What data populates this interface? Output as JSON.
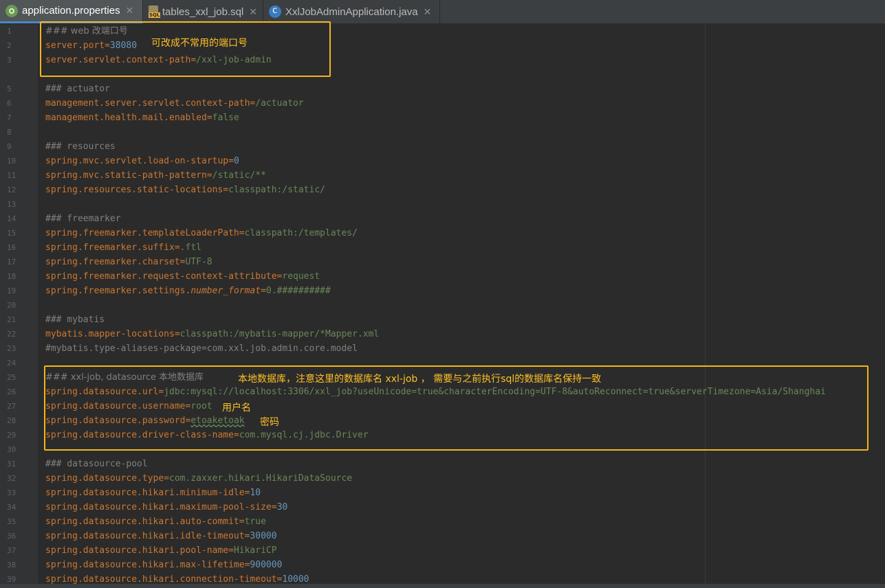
{
  "tabs": [
    {
      "label": "application.properties",
      "icon": "spring-leaf-icon",
      "active": true
    },
    {
      "label": "tables_xxl_job.sql",
      "icon": "sql-file-icon",
      "active": false
    },
    {
      "label": "XxlJobAdminApplication.java",
      "icon": "java-class-icon",
      "active": false
    }
  ],
  "close_glyph": "✕",
  "line_numbers": [
    "1",
    "2",
    "3",
    "",
    "5",
    "6",
    "7",
    "8",
    "9",
    "10",
    "11",
    "12",
    "13",
    "14",
    "15",
    "16",
    "17",
    "18",
    "19",
    "20",
    "21",
    "22",
    "23",
    "24",
    "25",
    "26",
    "27",
    "28",
    "29",
    "30",
    "31",
    "32",
    "33",
    "34",
    "35",
    "36",
    "37",
    "38",
    "39"
  ],
  "code": {
    "l1": "### web 改端口号",
    "l2_key": "server.port",
    "l2_val": "38080",
    "l3_key": "server.servlet.context-path",
    "l3_val": "/xxl-job-admin",
    "l5": "### actuator",
    "l6_key": "management.server.servlet.context-path",
    "l6_val": "/actuator",
    "l7_key": "management.health.mail.enabled",
    "l7_val": "false",
    "l9": "### resources",
    "l10_key": "spring.mvc.servlet.load-on-startup",
    "l10_val": "0",
    "l11_key": "spring.mvc.static-path-pattern",
    "l11_val": "/static/**",
    "l12_key": "spring.resources.static-locations",
    "l12_val": "classpath:/static/",
    "l14": "### freemarker",
    "l15_key": "spring.freemarker.templateLoaderPath",
    "l15_val": "classpath:/templates/",
    "l16_key": "spring.freemarker.suffix",
    "l16_val": ".ftl",
    "l17_key": "spring.freemarker.charset",
    "l17_val": "UTF-8",
    "l18_key": "spring.freemarker.request-context-attribute",
    "l18_val": "request",
    "l19_key": "spring.freemarker.settings.",
    "l19_key_it": "number_format",
    "l19_val": "0.##########",
    "l21": "### mybatis",
    "l22_key": "mybatis.mapper-locations",
    "l22_val": "classpath:/mybatis-mapper/*Mapper.xml",
    "l23": "#mybatis.type-aliases-package=com.xxl.job.admin.core.model",
    "l25": "### xxl-job, datasource 本地数据库",
    "l26_key": "spring.datasource.url",
    "l26_val": "jdbc:mysql://localhost:3306/xxl_job?useUnicode=true&characterEncoding=UTF-8&autoReconnect=true&serverTimezone=Asia/Shanghai",
    "l27_key": "spring.datasource.username",
    "l27_val": "root",
    "l28_key": "spring.datasource.password",
    "l28_val": "etoaketoak",
    "l29_key": "spring.datasource.driver-class-name",
    "l29_val": "com.mysql.cj.jdbc.Driver",
    "l31": "### datasource-pool",
    "l32_key": "spring.datasource.type",
    "l32_val": "com.zaxxer.hikari.HikariDataSource",
    "l33_key": "spring.datasource.hikari.minimum-idle",
    "l33_val": "10",
    "l34_key": "spring.datasource.hikari.maximum-pool-size",
    "l34_val": "30",
    "l35_key": "spring.datasource.hikari.auto-commit",
    "l35_val": "true",
    "l36_key": "spring.datasource.hikari.idle-timeout",
    "l36_val": "30000",
    "l37_key": "spring.datasource.hikari.pool-name",
    "l37_val": "HikariCP",
    "l38_key": "spring.datasource.hikari.max-lifetime",
    "l38_val": "900000",
    "l39_key": "spring.datasource.hikari.connection-timeout",
    "l39_val": "10000"
  },
  "annotations": {
    "port_note": "可改成不常用的端口号",
    "db_note": "本地数据库，注意这里的数据库名 xxl-job ， 需要与之前执行sql的数据库名保持一致",
    "user_note": "用户名",
    "pwd_note": "密码"
  },
  "colors": {
    "annotation": "#ffc125",
    "highlight_box": "#f5b41e",
    "key": "#cc7832",
    "value": "#6a8759",
    "comment": "#808080"
  }
}
